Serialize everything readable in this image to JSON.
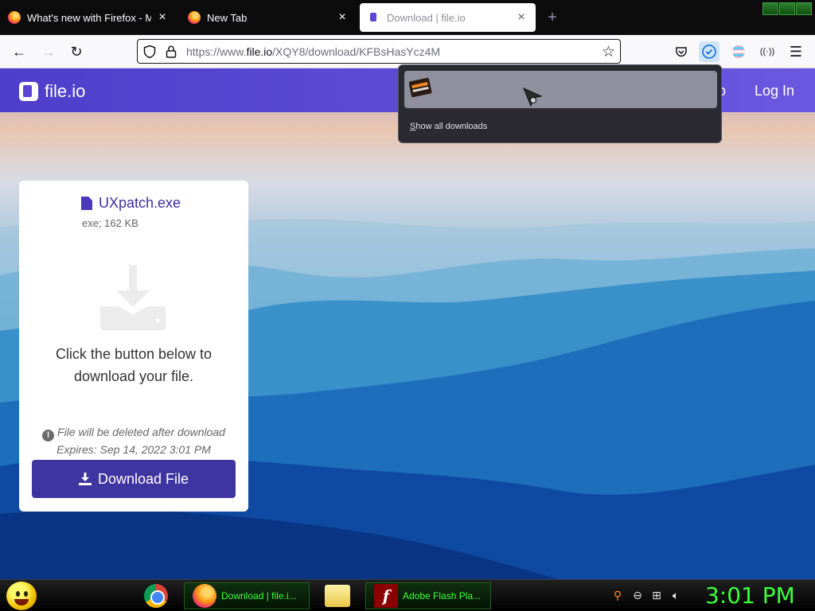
{
  "browser": {
    "tabs": [
      {
        "title": "What's new with Firefox - More",
        "active": false
      },
      {
        "title": "New Tab",
        "active": false
      },
      {
        "title": "Download | file.io",
        "active": true
      }
    ],
    "url": {
      "prefix": "https://www.",
      "host": "file.io",
      "path": "/XQY8/download/KFBsHasYcz4M"
    }
  },
  "site": {
    "logo_text": "file.io",
    "header_partial_link": "o",
    "login_label": "Log In"
  },
  "file_card": {
    "file_name": "UXpatch.exe",
    "file_meta": "exe; 162 KB",
    "message_line1": "Click the button below to",
    "message_line2": "download your file.",
    "notice_line1": "File will be deleted after download",
    "notice_line2": "Expires: Sep 14, 2022 3:01 PM",
    "download_label": "Download File"
  },
  "downloads_panel": {
    "item_name": "",
    "item_status": "",
    "show_all_label": "Show all downloads",
    "show_all_underline": "S",
    "show_all_rest": "how all downloads"
  },
  "taskbar": {
    "tasks": [
      {
        "label": "Download | file.i..."
      },
      {
        "label": "Adobe Flash Pla..."
      }
    ],
    "clock": "3:01 PM"
  },
  "colors": {
    "site_purple": "#5b44d6",
    "button_purple": "#3f35a0",
    "taskbar_green": "#3bff3b"
  }
}
